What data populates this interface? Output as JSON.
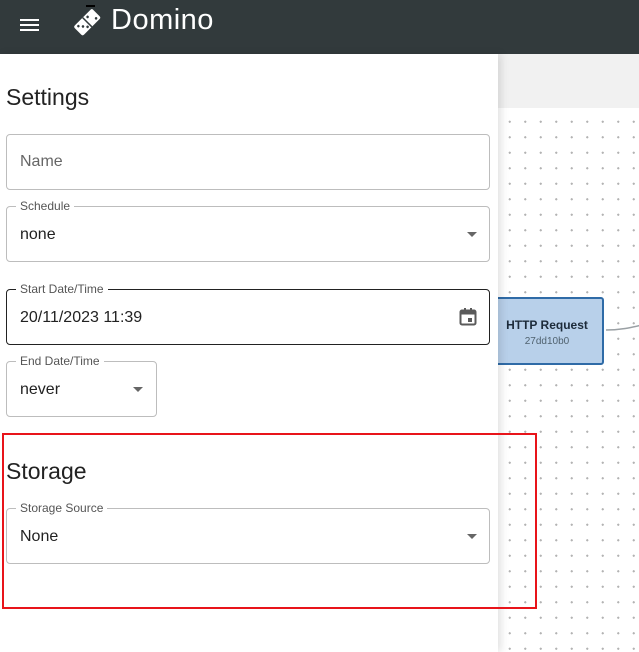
{
  "app": {
    "title": "Domino",
    "menu_icon": "hamburger-menu-icon",
    "logo_icon": "domino-logo-icon"
  },
  "settings": {
    "title": "Settings",
    "name_field": {
      "placeholder": "Name",
      "value": ""
    },
    "schedule": {
      "label": "Schedule",
      "value": "none"
    },
    "start_datetime": {
      "label": "Start Date/Time",
      "value": "20/11/2023 11:39",
      "icon": "calendar-icon"
    },
    "end_datetime": {
      "label": "End Date/Time",
      "value": "never"
    }
  },
  "storage": {
    "title": "Storage",
    "source": {
      "label": "Storage Source",
      "value": "None"
    }
  },
  "canvas": {
    "node": {
      "title": "HTTP Request",
      "id": "27dd10b0",
      "fill_color": "#b8d0ea",
      "border_color": "#2f6ba7"
    }
  },
  "colors": {
    "topbar": "#323a3c",
    "highlight": "#e8141a"
  }
}
